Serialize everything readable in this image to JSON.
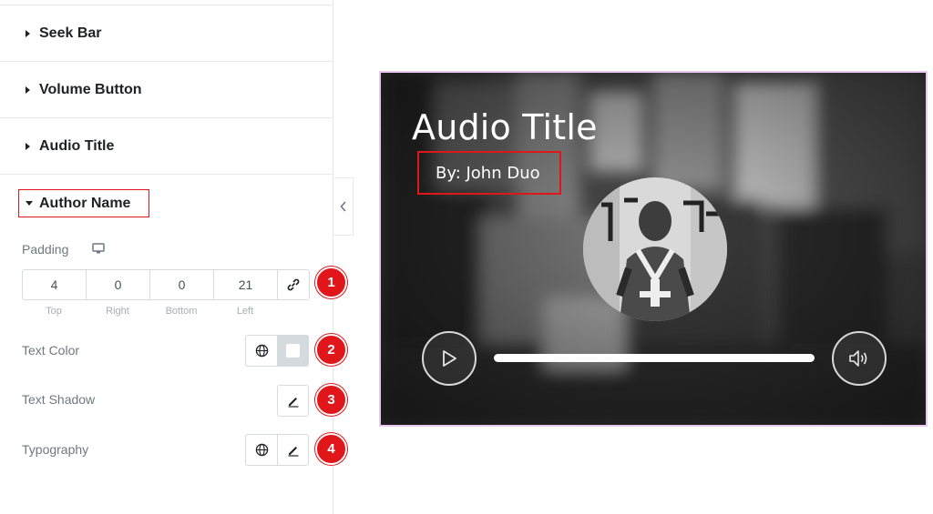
{
  "panel": {
    "sections": [
      {
        "label": "Seek Bar"
      },
      {
        "label": "Volume Button"
      },
      {
        "label": "Audio Title"
      }
    ],
    "open_section": {
      "label": "Author Name"
    },
    "padding": {
      "label": "Padding",
      "device_icon": "desktop-monitor-icon",
      "values": {
        "top": "4",
        "right": "0",
        "bottom": "0",
        "left": "21"
      },
      "captions": {
        "top": "Top",
        "right": "Right",
        "bottom": "Bottom",
        "left": "Left"
      },
      "link_icon": "link-icon"
    },
    "text_color": {
      "label": "Text Color",
      "globe_icon": "globe-icon",
      "swatch": "#ffffff"
    },
    "text_shadow": {
      "label": "Text Shadow",
      "edit_icon": "pencil-icon"
    },
    "typography": {
      "label": "Typography",
      "globe_icon": "globe-icon",
      "edit_icon": "pencil-icon"
    },
    "collapse_icon": "chevron-left-icon"
  },
  "badges": [
    "1",
    "2",
    "3",
    "4"
  ],
  "player": {
    "title": "Audio Title",
    "author": "By: John Duo",
    "play_icon": "play-icon",
    "volume_icon": "volume-icon"
  },
  "colors": {
    "highlight_red": "#e0161b",
    "player_border": "#e8c8f0",
    "label_gray": "#6d7882"
  }
}
